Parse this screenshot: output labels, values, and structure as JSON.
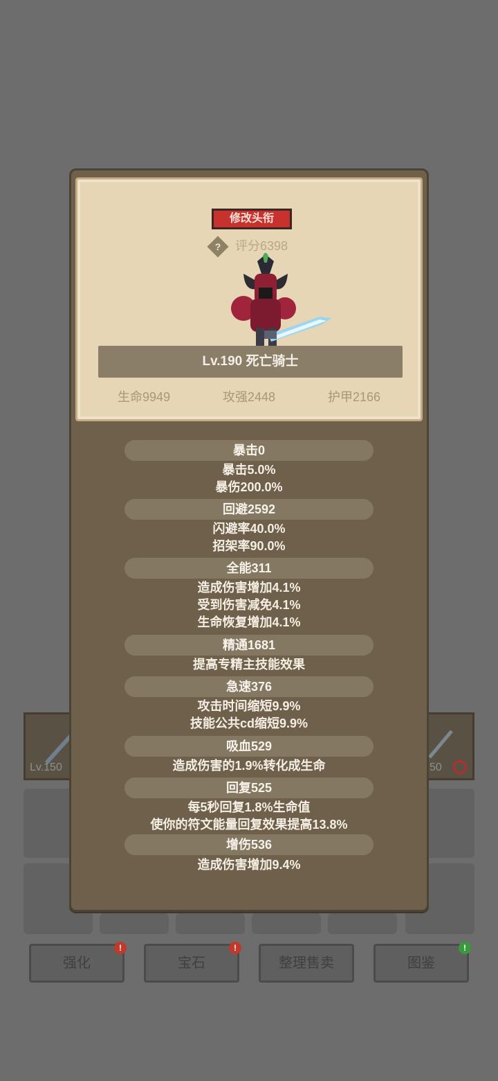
{
  "background": {
    "left_item_level": "Lv.150",
    "right_item_level": "50",
    "buttons": [
      {
        "label": "强化",
        "badge": "!",
        "badge_color": "#c0392b"
      },
      {
        "label": "宝石",
        "badge": "!",
        "badge_color": "#c0392b"
      },
      {
        "label": "整理售卖",
        "badge": "",
        "badge_color": ""
      },
      {
        "label": "图鉴",
        "badge": "!",
        "badge_color": "#3a9a3a"
      }
    ]
  },
  "header": {
    "title_button": "修改头衔",
    "help_icon": "?",
    "score": "评分6398",
    "hero_name": "Lv.190 死亡骑士",
    "stats": {
      "hp": "生命9949",
      "atk": "攻强2448",
      "armor": "护甲2166"
    }
  },
  "sections": [
    {
      "title": "暴击0",
      "lines": [
        "暴击5.0%",
        "暴伤200.0%"
      ]
    },
    {
      "title": "回避2592",
      "lines": [
        "闪避率40.0%",
        "招架率90.0%"
      ]
    },
    {
      "title": "全能311",
      "lines": [
        "造成伤害增加4.1%",
        "受到伤害减免4.1%",
        "生命恢复增加4.1%"
      ]
    },
    {
      "title": "精通1681",
      "lines": [
        "提高专精主技能效果"
      ]
    },
    {
      "title": "急速376",
      "lines": [
        "攻击时间缩短9.9%",
        "技能公共cd缩短9.9%"
      ]
    },
    {
      "title": "吸血529",
      "lines": [
        "造成伤害的1.9%转化成生命"
      ]
    },
    {
      "title": "回复525",
      "lines": [
        "每5秒回复1.8%生命值",
        "使你的符文能量回复效果提高13.8%"
      ]
    },
    {
      "title": "增伤536",
      "lines": [
        "造成伤害增加9.4%"
      ]
    }
  ],
  "colors": {
    "title_button": "#c8322e",
    "parchment": "#e7d6b5",
    "panel": "#6e604a"
  }
}
